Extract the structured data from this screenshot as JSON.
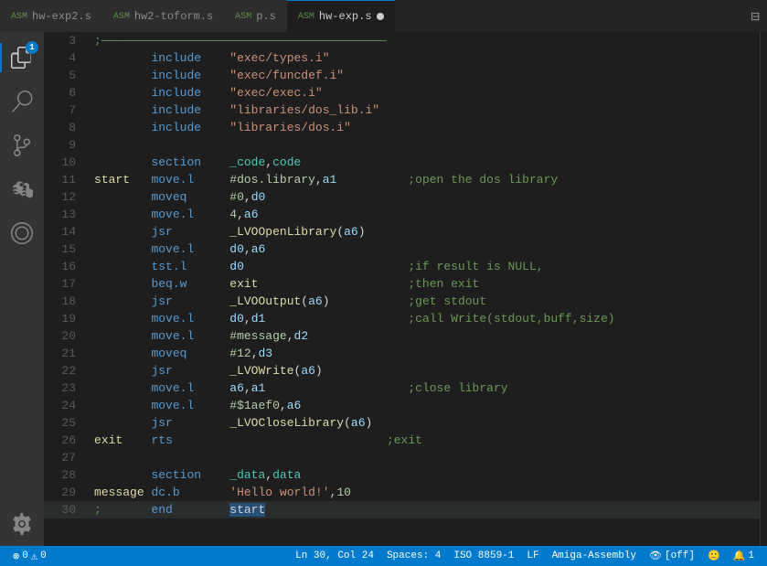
{
  "tabs": [
    {
      "id": "hw-exp2",
      "lang": "ASM",
      "name": "hw-exp2.s",
      "active": false,
      "dirty": false
    },
    {
      "id": "hw2-toform",
      "lang": "ASM",
      "name": "hw2-toform.s",
      "active": false,
      "dirty": false
    },
    {
      "id": "p",
      "lang": "ASM",
      "name": "p.s",
      "active": false,
      "dirty": false
    },
    {
      "id": "hw-exp",
      "lang": "ASM",
      "name": "hw-exp.s",
      "active": true,
      "dirty": true
    }
  ],
  "activity": {
    "icons": [
      "files",
      "search",
      "source-control",
      "extensions",
      "remote-explorer",
      "settings"
    ],
    "badge": "1"
  },
  "statusBar": {
    "errors": "0",
    "warnings": "0",
    "line": "Ln 30, Col 24",
    "spaces": "Spaces: 4",
    "encoding": "ISO 8859-1",
    "eol": "LF",
    "language": "Amiga-Assembly",
    "eye_label": "[off]"
  },
  "lines": [
    {
      "num": "3",
      "content": ";——————————————————————————————————————————————"
    },
    {
      "num": "4",
      "content": "        include    \"exec/types.i\""
    },
    {
      "num": "5",
      "content": "        include    \"exec/funcdef.i\""
    },
    {
      "num": "6",
      "content": "        include    \"exec/exec.i\""
    },
    {
      "num": "7",
      "content": "        include    \"libraries/dos_lib.i\""
    },
    {
      "num": "8",
      "content": "        include    \"libraries/dos.i\""
    },
    {
      "num": "9",
      "content": ""
    },
    {
      "num": "10",
      "content": "        section    _code,code"
    },
    {
      "num": "11",
      "content": "start   move.l     #dos.library,a1          ;open the dos library"
    },
    {
      "num": "12",
      "content": "        moveq      #0,d0"
    },
    {
      "num": "13",
      "content": "        move.l     4,a6"
    },
    {
      "num": "14",
      "content": "        jsr        _LVOOpenLibrary(a6)"
    },
    {
      "num": "15",
      "content": "        move.l     d0,a6"
    },
    {
      "num": "16",
      "content": "        tst.l      d0                       ;if result is NULL,"
    },
    {
      "num": "17",
      "content": "        beq.w      exit                     ;then exit"
    },
    {
      "num": "18",
      "content": "        jsr        _LVOOutput(a6)           ;get stdout"
    },
    {
      "num": "19",
      "content": "        move.l     d0,d1                    ;call Write(stdout,buff,size)"
    },
    {
      "num": "20",
      "content": "        move.l     #message,d2"
    },
    {
      "num": "21",
      "content": "        moveq      #12,d3"
    },
    {
      "num": "22",
      "content": "        jsr        _LVOWrite(a6)"
    },
    {
      "num": "23",
      "content": "        move.l     a6,a1                    ;close library"
    },
    {
      "num": "24",
      "content": "        move.l     #$1aef0,a6"
    },
    {
      "num": "25",
      "content": "        jsr        _LVOCloseLibrary(a6)"
    },
    {
      "num": "26",
      "content": "exit    rts                              ;exit"
    },
    {
      "num": "27",
      "content": ""
    },
    {
      "num": "28",
      "content": "        section    _data,data"
    },
    {
      "num": "29",
      "content": "message dc.b       'Hello world!',10"
    },
    {
      "num": "30",
      "content": ";       end        start"
    }
  ]
}
